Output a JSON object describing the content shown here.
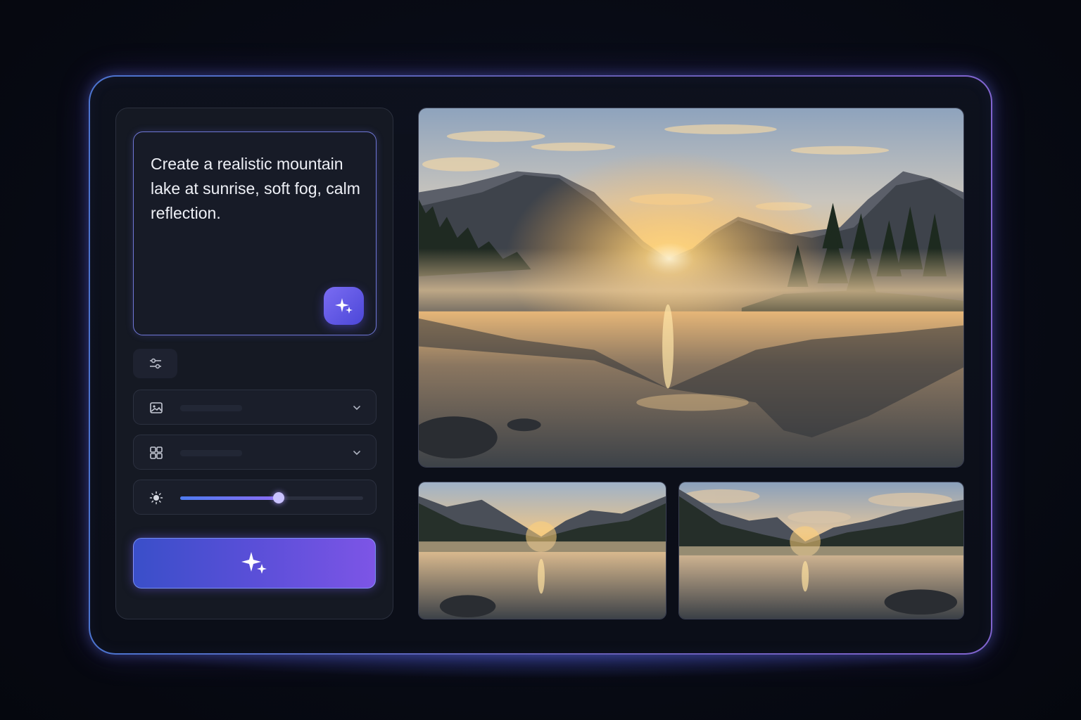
{
  "prompt": {
    "text": "Create a realistic mountain lake at sunrise, soft fog, calm reflection."
  },
  "controls": {
    "style_icon": "image-icon",
    "layout_icon": "grid-icon",
    "brightness_icon": "sun-icon",
    "brightness_level": 0.54,
    "settings_icon": "sliders-icon",
    "generate_icon": "sparkles-icon"
  },
  "gallery": {
    "main_image": "mountain-lake-sunrise",
    "thumbnails": [
      "mountain-lake-sunrise-variant-1",
      "mountain-lake-sunrise-variant-2"
    ]
  },
  "colors": {
    "accent": "#6a5ce6",
    "frame_glow": "#8c96ff"
  }
}
